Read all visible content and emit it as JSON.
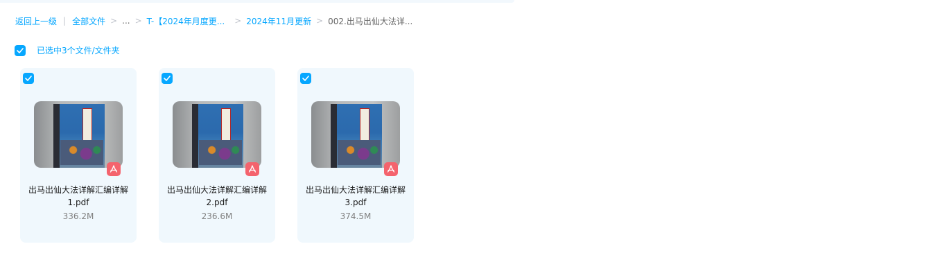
{
  "breadcrumb": {
    "back_label": "返回上一级",
    "separator": "|",
    "items": [
      {
        "label": "全部文件"
      },
      {
        "label": "..."
      },
      {
        "label": "T-【2024年月度更..."
      },
      {
        "label": "2024年11月更新"
      },
      {
        "label": "002.出马出仙大法详..."
      }
    ],
    "arrow": ">"
  },
  "selection": {
    "checked": true,
    "label": "已选中3个文件/文件夹"
  },
  "files": [
    {
      "name_line1": "出马出仙大法详解汇编详解",
      "name_line2": "1.pdf",
      "size": "336.2M",
      "checked": true,
      "type_icon": "pdf-icon"
    },
    {
      "name_line1": "出马出仙大法详解汇编详解",
      "name_line2": "2.pdf",
      "size": "236.6M",
      "checked": true,
      "type_icon": "pdf-icon"
    },
    {
      "name_line1": "出马出仙大法详解汇编详解",
      "name_line2": "3.pdf",
      "size": "374.5M",
      "checked": true,
      "type_icon": "pdf-icon"
    }
  ],
  "colors": {
    "accent": "#06a7ff",
    "card_bg": "#f0f8fd",
    "pdf_badge": "#f4636d"
  }
}
